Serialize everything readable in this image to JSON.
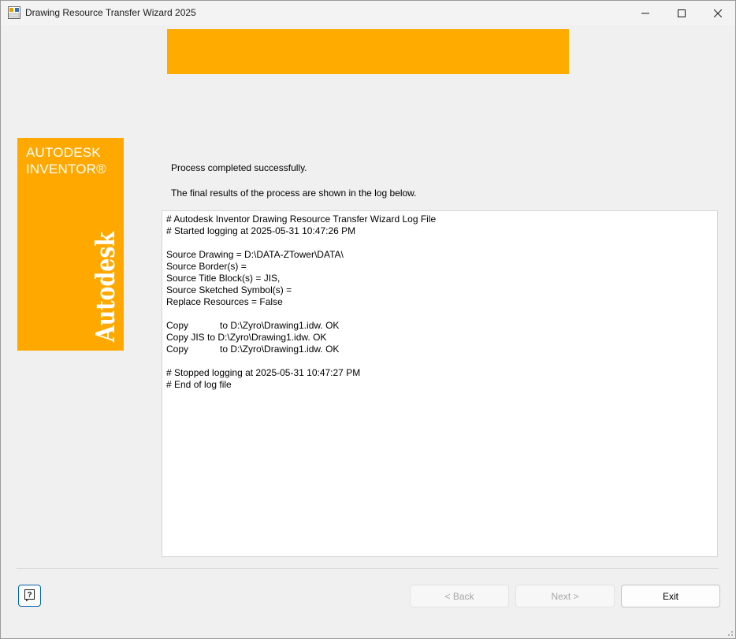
{
  "window": {
    "title": "Drawing Resource Transfer Wizard 2025",
    "icon": "wizard-app-icon",
    "controls": [
      "minimize-icon",
      "maximize-icon",
      "close-icon"
    ]
  },
  "brand": {
    "line1": "AUTODESK",
    "line2": "INVENTOR®",
    "vertical": "Autodesk",
    "color": "#ffa800",
    "banner_color": "#ffab00"
  },
  "messages": {
    "status": "Process completed successfully.",
    "info": "The final results of the process are shown in the log below."
  },
  "log": {
    "lines": [
      "# Autodesk Inventor Drawing Resource Transfer Wizard Log File",
      "# Started logging at 2025-05-31 10:47:26 PM",
      "",
      "Source Drawing = D:\\DATA-ZTower\\DATA\\",
      "Source Border(s) =",
      "Source Title Block(s) = JIS,",
      "Source Sketched Symbol(s) =",
      "Replace Resources = False",
      "",
      "Copy            to D:\\Zyro\\Drawing1.idw. OK",
      "Copy JIS to D:\\Zyro\\Drawing1.idw. OK",
      "Copy            to D:\\Zyro\\Drawing1.idw. OK",
      "",
      "# Stopped logging at 2025-05-31 10:47:27 PM",
      "# End of log file"
    ]
  },
  "buttons": {
    "help_icon": "help-icon",
    "back": "< Back",
    "next": "Next >",
    "exit": "Exit"
  }
}
